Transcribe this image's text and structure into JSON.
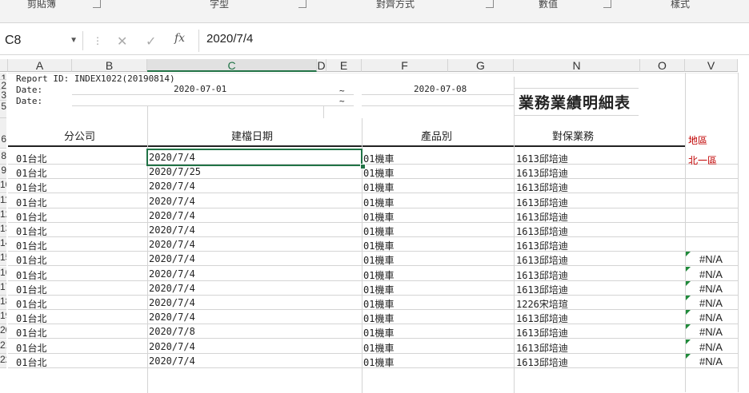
{
  "ribbon": {
    "groups": [
      "剪貼簿",
      "字型",
      "對齊方式",
      "數值",
      "樣式"
    ]
  },
  "formula_bar": {
    "name_box": "C8",
    "fx_label": "fx",
    "formula": "2020/7/4"
  },
  "columns": [
    "A",
    "B",
    "C",
    "D",
    "E",
    "F",
    "G",
    "N",
    "O",
    "V"
  ],
  "row_numbers": [
    "1",
    "2",
    "3",
    "5",
    "6",
    "8",
    "9",
    "10",
    "11",
    "12",
    "13",
    "14",
    "15",
    "16",
    "17",
    "18",
    "19",
    "20",
    "21",
    "22"
  ],
  "header_block": {
    "report_id": "Report ID: INDEX1022(20190814)",
    "date1_label": "Date:",
    "date2_label": "Date:",
    "date_from": "2020-07-01",
    "date_to": "2020-07-08",
    "tilde1": "~",
    "tilde2": "~",
    "title": "業務業績明細表"
  },
  "table_headers": {
    "branch": "分公司",
    "created_date": "建檔日期",
    "product": "產品別",
    "salesperson": "對保業務",
    "region": "地區"
  },
  "first_region": "北一區",
  "rows": [
    {
      "branch": "01台北",
      "date": "2020/7/4",
      "product": "01機車",
      "sales": "1613邱培迪",
      "region": ""
    },
    {
      "branch": "01台北",
      "date": "2020/7/25",
      "product": "01機車",
      "sales": "1613邱培迪",
      "region": ""
    },
    {
      "branch": "01台北",
      "date": "2020/7/4",
      "product": "01機車",
      "sales": "1613邱培迪",
      "region": ""
    },
    {
      "branch": "01台北",
      "date": "2020/7/4",
      "product": "01機車",
      "sales": "1613邱培迪",
      "region": ""
    },
    {
      "branch": "01台北",
      "date": "2020/7/4",
      "product": "01機車",
      "sales": "1613邱培迪",
      "region": ""
    },
    {
      "branch": "01台北",
      "date": "2020/7/4",
      "product": "01機車",
      "sales": "1613邱培迪",
      "region": ""
    },
    {
      "branch": "01台北",
      "date": "2020/7/4",
      "product": "01機車",
      "sales": "1613邱培迪",
      "region": ""
    },
    {
      "branch": "01台北",
      "date": "2020/7/4",
      "product": "01機車",
      "sales": "1613邱培迪",
      "region": "#N/A"
    },
    {
      "branch": "01台北",
      "date": "2020/7/4",
      "product": "01機車",
      "sales": "1613邱培迪",
      "region": "#N/A"
    },
    {
      "branch": "01台北",
      "date": "2020/7/4",
      "product": "01機車",
      "sales": "1613邱培迪",
      "region": "#N/A"
    },
    {
      "branch": "01台北",
      "date": "2020/7/4",
      "product": "01機車",
      "sales": "1226宋培瑄",
      "region": "#N/A"
    },
    {
      "branch": "01台北",
      "date": "2020/7/4",
      "product": "01機車",
      "sales": "1613邱培迪",
      "region": "#N/A"
    },
    {
      "branch": "01台北",
      "date": "2020/7/8",
      "product": "01機車",
      "sales": "1613邱培迪",
      "region": "#N/A"
    },
    {
      "branch": "01台北",
      "date": "2020/7/4",
      "product": "01機車",
      "sales": "1613邱培迪",
      "region": "#N/A"
    },
    {
      "branch": "01台北",
      "date": "2020/7/4",
      "product": "01機車",
      "sales": "1613邱培迪",
      "region": "#N/A"
    }
  ]
}
